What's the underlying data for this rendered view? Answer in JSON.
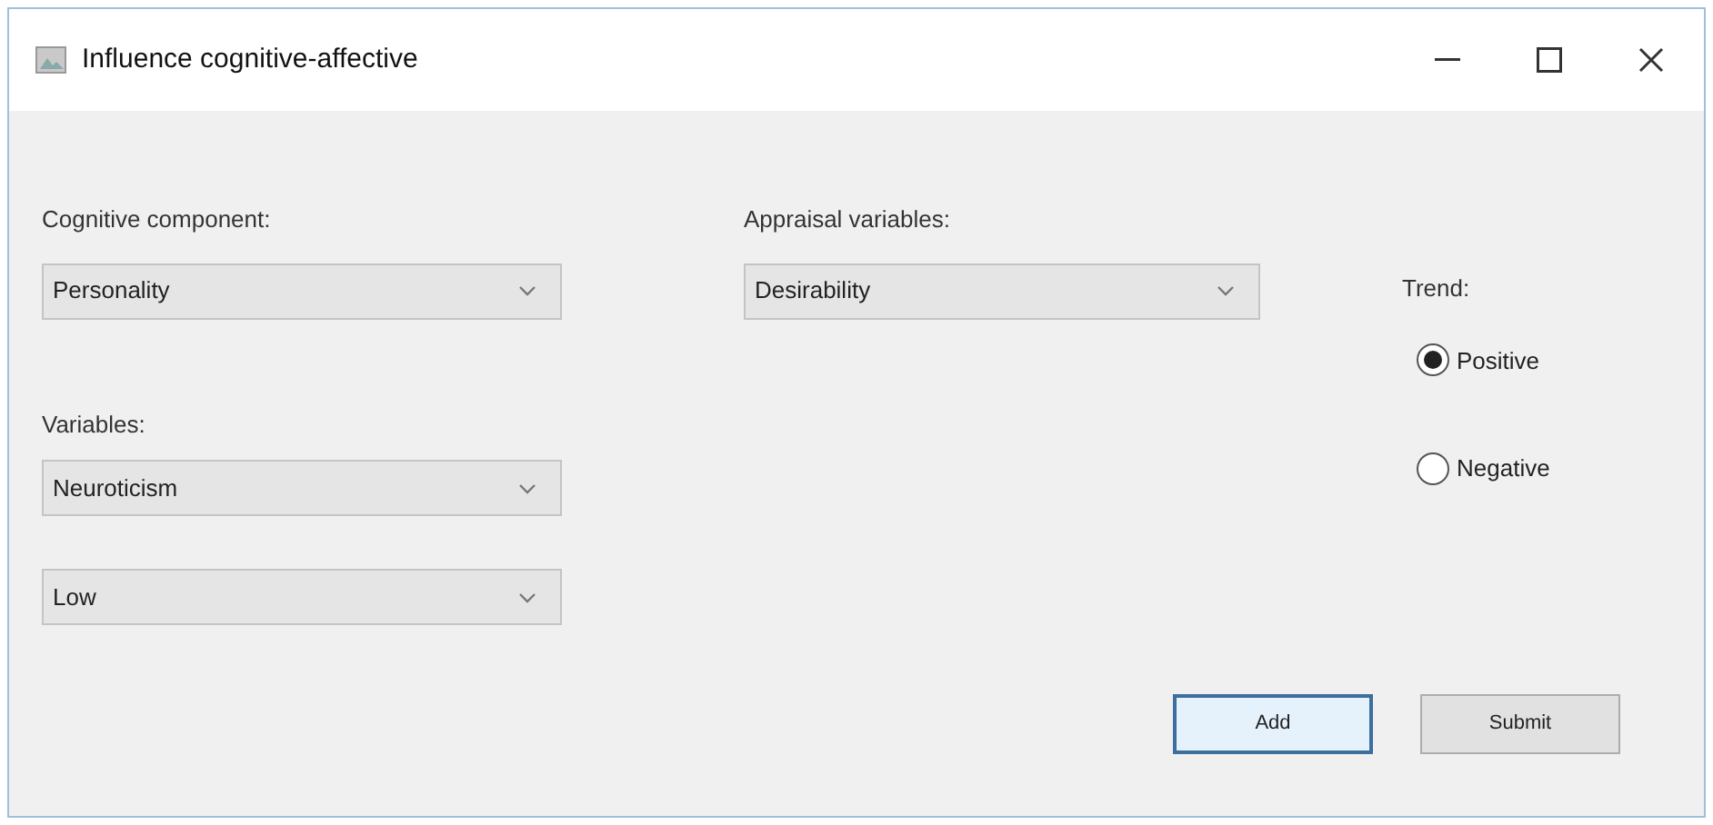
{
  "window": {
    "title": "Influence cognitive-affective"
  },
  "left": {
    "cognitive_label": "Cognitive component:",
    "cognitive_value": "Personality",
    "variables_label": "Variables:",
    "variable_value": "Neuroticism",
    "level_value": "Low"
  },
  "middle": {
    "appraisal_label": "Appraisal variables:",
    "appraisal_value": "Desirability"
  },
  "trend": {
    "label": "Trend:",
    "options": [
      {
        "label": "Positive",
        "selected": true
      },
      {
        "label": "Negative",
        "selected": false
      }
    ]
  },
  "buttons": [
    {
      "label": "Add",
      "focused": true
    },
    {
      "label": "Submit",
      "focused": false
    }
  ]
}
